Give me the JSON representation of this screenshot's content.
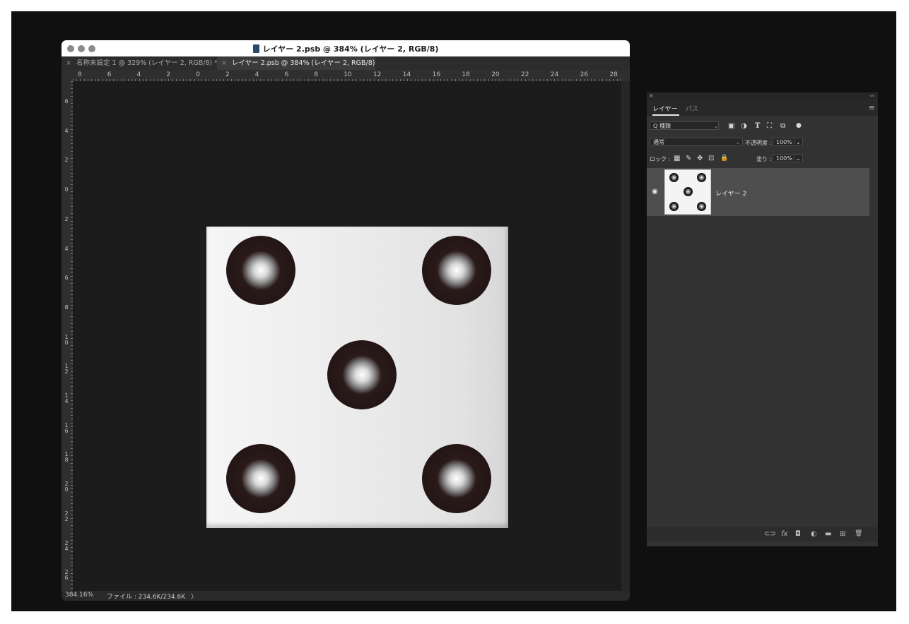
{
  "document_window": {
    "title": "レイヤー 2.psb @ 384% (レイヤー 2, RGB/8)",
    "tabs": [
      {
        "label": "名称未設定 1 @ 329% (レイヤー 2, RGB/8) *",
        "close": "×"
      },
      {
        "label": "レイヤー 2.psb @ 384% (レイヤー 2, RGB/8)",
        "close": "×"
      }
    ],
    "ruler_top_labels": [
      "8",
      "6",
      "4",
      "2",
      "0",
      "2",
      "4",
      "6",
      "8",
      "10",
      "12",
      "14",
      "16",
      "18",
      "20",
      "22",
      "24",
      "26",
      "28"
    ],
    "ruler_left_labels": [
      "6",
      "4",
      "2",
      "0",
      "2",
      "4",
      "6",
      "8",
      "10",
      "12",
      "14",
      "16",
      "18",
      "20",
      "22",
      "24",
      "26"
    ],
    "status": {
      "zoom": "384.16%",
      "file": "ファイル : 234.6K/234.6K",
      "arrow": "〉"
    }
  },
  "canvas_image": {
    "description_icon": "dice-five-icon",
    "pips": 5
  },
  "layers_panel": {
    "close": "×",
    "collapse": "‹‹",
    "tabs": [
      "レイヤー",
      "パス"
    ],
    "menu_icon": "≡",
    "filter": {
      "label": "Q 種類",
      "icons": [
        "▣",
        "◑",
        "T",
        "⛶",
        "⧉",
        "●"
      ]
    },
    "blend_mode": "通常",
    "opacity_label": "不透明度 :",
    "opacity_value": "100%",
    "lock_label": "ロック :",
    "lock_icons": [
      "▦",
      "✎",
      "✥",
      "⊡",
      "🔒"
    ],
    "fill_label": "塗り :",
    "fill_value": "100%",
    "layers": [
      {
        "name": "レイヤー 2",
        "visible": true
      }
    ],
    "bottom_icons": [
      "⊂⊃",
      "fx",
      "◘",
      "◐",
      "▬",
      "⊞",
      "🗑"
    ]
  }
}
